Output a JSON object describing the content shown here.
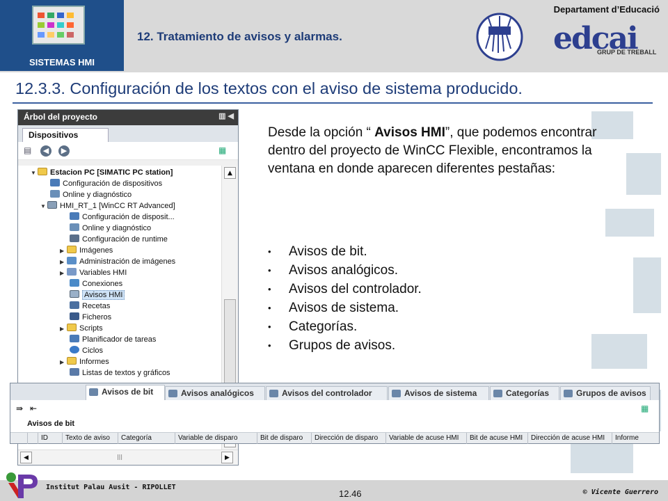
{
  "header": {
    "logo_caption": "SISTEMAS HMI",
    "section_title": "12. Tratamiento de avisos y alarmas.",
    "department": "Departament d’Educació",
    "brand": "edcai",
    "brand_sub": "GRUP DE TREBALL"
  },
  "slide_title": "12.3.3. Configuración de los textos con el aviso de sistema producido.",
  "tree": {
    "title": "Árbol del proyecto",
    "tab": "Dispositivos",
    "items": [
      {
        "label": "Estacion PC [SIMATIC PC station]",
        "icon": "folder-icon"
      },
      {
        "label": "Configuración de dispositivos",
        "icon": "device-config-icon"
      },
      {
        "label": "Online y diagnóstico",
        "icon": "online-diagnostics-icon"
      },
      {
        "label": "HMI_RT_1 [WinCC RT Advanced]",
        "icon": "hmi-runtime-icon"
      },
      {
        "label": "Configuración de disposit...",
        "icon": "device-config-icon"
      },
      {
        "label": "Online y diagnóstico",
        "icon": "online-diagnostics-icon"
      },
      {
        "label": "Configuración de runtime",
        "icon": "runtime-config-icon"
      },
      {
        "label": "Imágenes",
        "icon": "folder-icon"
      },
      {
        "label": "Administración de imágenes",
        "icon": "image-management-icon"
      },
      {
        "label": "Variables HMI",
        "icon": "tags-icon"
      },
      {
        "label": "Conexiones",
        "icon": "connections-icon"
      },
      {
        "label": "Avisos HMI",
        "icon": "alarms-icon"
      },
      {
        "label": "Recetas",
        "icon": "recipes-icon"
      },
      {
        "label": "Ficheros",
        "icon": "logs-icon"
      },
      {
        "label": "Scripts",
        "icon": "scripts-icon"
      },
      {
        "label": "Planificador de tareas",
        "icon": "scheduler-icon"
      },
      {
        "label": "Ciclos",
        "icon": "cycles-icon"
      },
      {
        "label": "Informes",
        "icon": "reports-icon"
      },
      {
        "label": "Listas de textos y gráficos",
        "icon": "text-graphic-lists-icon"
      }
    ]
  },
  "body": {
    "para_prefix": "Desde la opción “ ",
    "para_bold": "Avisos HMI",
    "para_suffix": "”, que podemos encontrar dentro del proyecto de WinCC Flexible, encontramos la ventana en donde aparecen diferentes pestañas:",
    "bullets": [
      "Avisos de bit.",
      "Avisos analógicos.",
      "Avisos del controlador.",
      "Avisos de sistema.",
      "Categorías.",
      "Grupos de avisos."
    ]
  },
  "panel": {
    "tabs": [
      "Avisos de bit",
      "Avisos analógicos",
      "Avisos del controlador",
      "Avisos de sistema",
      "Categorías",
      "Grupos de avisos"
    ],
    "section": "Avisos de bit",
    "columns": [
      "ID",
      "Texto de aviso",
      "Categoría",
      "Variable de disparo",
      "Bit de disparo",
      "Dirección de disparo",
      "Variable de acuse HMI",
      "Bit de acuse HMI",
      "Dirección de acuse HMI",
      "Informe"
    ]
  },
  "footer": {
    "institute": "Institut Palau Ausit - RIPOLLET",
    "page": "12.46",
    "author": "© Vicente Guerrero"
  }
}
